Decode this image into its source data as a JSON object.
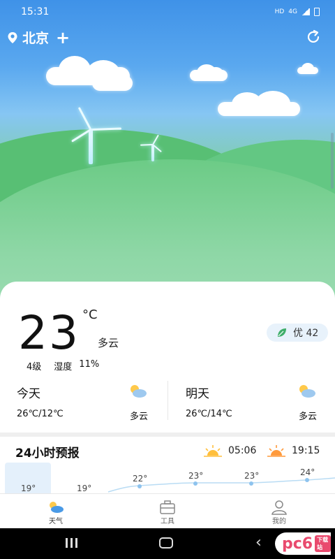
{
  "status_bar": {
    "time": "15:31",
    "network": "HD",
    "signal_label": "4G"
  },
  "header": {
    "city": "北京"
  },
  "current": {
    "temperature": "23",
    "unit": "°C",
    "condition": "多云",
    "wind": "4级",
    "humidity_label": "湿度",
    "humidity": "11%"
  },
  "aqi": {
    "label": "优 42"
  },
  "today": {
    "label": "今天",
    "temp_range": "26℃/12℃",
    "condition": "多云"
  },
  "tomorrow": {
    "label": "明天",
    "temp_range": "26℃/14℃",
    "condition": "多云"
  },
  "forecast": {
    "title": "24小时预报",
    "sunrise": "05:06",
    "sunset": "19:15",
    "hours": [
      {
        "temp": "19°"
      },
      {
        "temp": "19°"
      },
      {
        "temp": "22°"
      },
      {
        "temp": "23°"
      },
      {
        "temp": "23°"
      },
      {
        "temp": "24°"
      }
    ]
  },
  "bottom_nav": [
    {
      "label": "天气",
      "icon": "weather-icon"
    },
    {
      "label": "工具",
      "icon": "toolbox-icon"
    },
    {
      "label": "我的",
      "icon": "profile-icon"
    }
  ],
  "watermark": {
    "text": "pc6",
    "tag": "下载站"
  },
  "colors": {
    "accent": "#4a9ae6",
    "sky_top": "#3f92e8",
    "grass": "#6ccb86",
    "aqi_bg": "#e8f2fb"
  }
}
